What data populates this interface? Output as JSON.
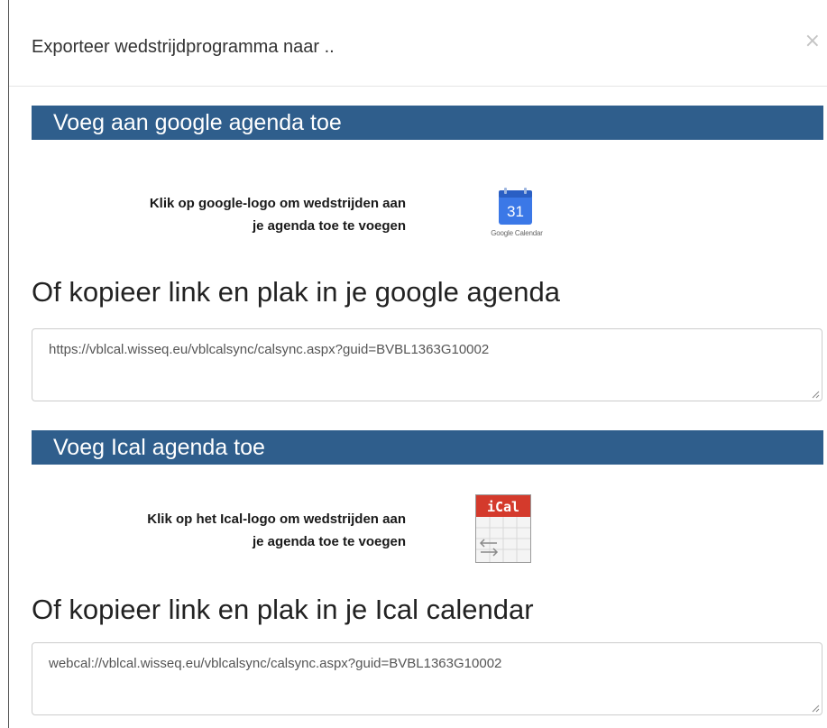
{
  "modal": {
    "title": "Exporteer wedstrijdprogramma naar ..",
    "close_label": "×"
  },
  "google_section": {
    "heading": "Voeg aan google agenda toe",
    "instruction_line1": "Klik op google-logo om wedstrijden aan",
    "instruction_line2": "je agenda toe te voegen",
    "logo_number": "31",
    "logo_caption": "Google Calendar",
    "copy_label": "Of kopieer link en plak in je google agenda",
    "link_value": "https://vblcal.wisseq.eu/vblcalsync/calsync.aspx?guid=BVBL1363G10002"
  },
  "ical_section": {
    "heading": "Voeg Ical agenda toe",
    "instruction_line1": "Klik op het Ical-logo om wedstrijden aan",
    "instruction_line2": "je agenda toe te voegen",
    "logo_text": "iCal",
    "copy_label": "Of kopieer link en plak in je Ical calendar",
    "link_value": "webcal://vblcal.wisseq.eu/vblcalsync/calsync.aspx?guid=BVBL1363G10002"
  },
  "colors": {
    "section_bar": "#2f5e8c",
    "google_blue": "#3b78e7",
    "ical_red": "#d43a2c"
  }
}
